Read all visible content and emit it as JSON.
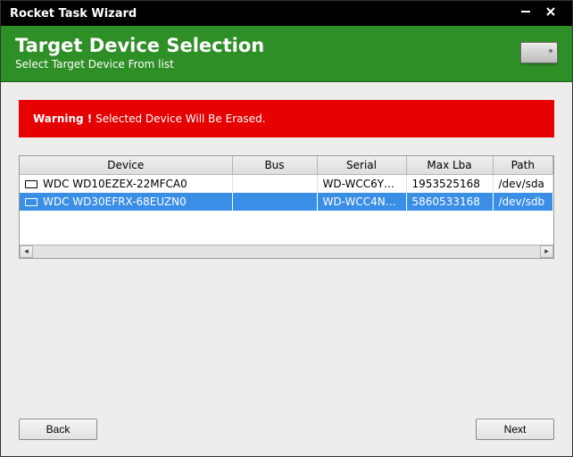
{
  "window": {
    "title": "Rocket Task Wizard"
  },
  "header": {
    "title": "Target Device Selection",
    "subtitle": "Select Target Device From list"
  },
  "warning": {
    "label": "Warning !",
    "text": " Selected Device Will Be Erased."
  },
  "table": {
    "columns": [
      "Device",
      "Bus",
      "Serial",
      "Max Lba",
      "Path"
    ],
    "rows": [
      {
        "device": "WDC WD10EZEX-22MFCA0",
        "bus": "",
        "serial": "WD-WCC6Y3…",
        "maxlba": "1953525168",
        "path": "/dev/sda",
        "selected": false
      },
      {
        "device": "WDC WD30EFRX-68EUZN0",
        "bus": "",
        "serial": "WD-WCC4N3…",
        "maxlba": "5860533168",
        "path": "/dev/sdb",
        "selected": true
      }
    ]
  },
  "footer": {
    "back": "Back",
    "next": "Next"
  }
}
